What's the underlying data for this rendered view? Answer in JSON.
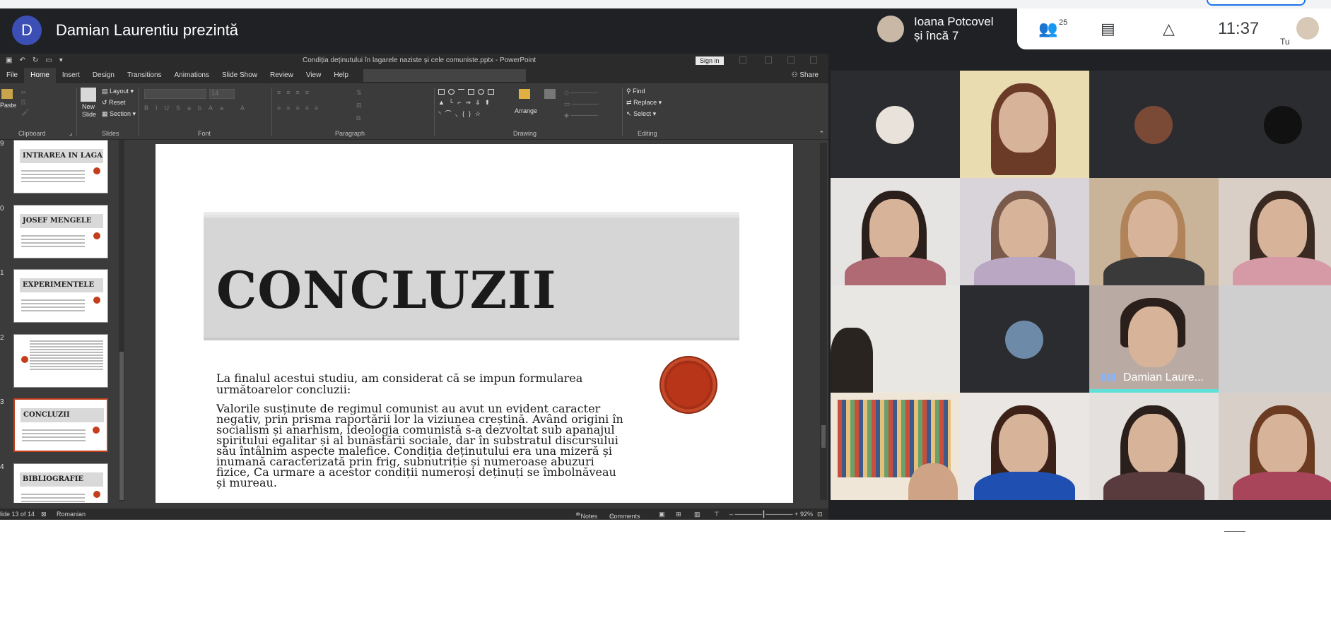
{
  "presenter": {
    "avatar_letter": "D",
    "name": "Damian Laurentiu prezintă"
  },
  "ppt": {
    "doc_title": "Condiția deținutului în lagarele naziste și cele comuniste.pptx  -  PowerPoint",
    "sign_in": "Sign in",
    "tabs": [
      "File",
      "Home",
      "Insert",
      "Design",
      "Transitions",
      "Animations",
      "Slide Show",
      "Review",
      "View",
      "Help"
    ],
    "active_tab": "Home",
    "share": "Share",
    "ribbon": {
      "paste": "Paste",
      "new_slide": "New Slide",
      "layout": "Layout",
      "reset": "Reset",
      "section": "Section",
      "font_size": "14",
      "arrange": "Arrange",
      "find": "Find",
      "replace": "Replace",
      "select": "Select",
      "groups": {
        "clipboard": "Clipboard",
        "slides": "Slides",
        "font": "Font",
        "paragraph": "Paragraph",
        "drawing": "Drawing",
        "editing": "Editing"
      }
    },
    "thumbnails": [
      {
        "num": "9",
        "title": "INTRAREA IN LAGAR"
      },
      {
        "num": "0",
        "title": "JOSEF MENGELE"
      },
      {
        "num": "1",
        "title": "EXPERIMENTELE"
      },
      {
        "num": "2",
        "title": ""
      },
      {
        "num": "3",
        "title": "CONCLUZII"
      },
      {
        "num": "4",
        "title": "BIBLIOGRAFIE"
      }
    ],
    "slide": {
      "heading": "CONCLUZII",
      "intro": "La finalul acestui studiu, am considerat că se impun formularea următoarelor concluzii:",
      "body": "Valorile susținute de regimul comunist au avut un evident caracter negativ, prin prisma raportării lor la viziunea creștină. Având origini în socialism și anarhism, ideologia comunistă s-a dezvoltat sub apanajul spiritului egalitar și al bunăstării sociale, dar în substratul discursului său întâlnim aspecte malefice. Condiția deținutului era una mizeră și inumană caracterizată prin frig, subnutriție și numeroase abuzuri fizice, Ca urmare a acestor condiții numeroși deținuți se îmbolnăveau și mureau."
    },
    "status": {
      "slide_of": "lide 13 of 14",
      "language": "Romanian",
      "notes": "Notes",
      "comments": "Comments",
      "zoom": "92%"
    }
  },
  "meet": {
    "participant_chip": {
      "line1": "Ioana Potcovel",
      "line2": "și încă 7"
    },
    "people_count": "25",
    "time": "11:37",
    "self_label": "Tu",
    "speaking_name": "Damian Laure..."
  },
  "colors": {
    "accent_red": "#c43e1c",
    "speaking": "#5ee0d8",
    "meet_bg": "#202124"
  }
}
